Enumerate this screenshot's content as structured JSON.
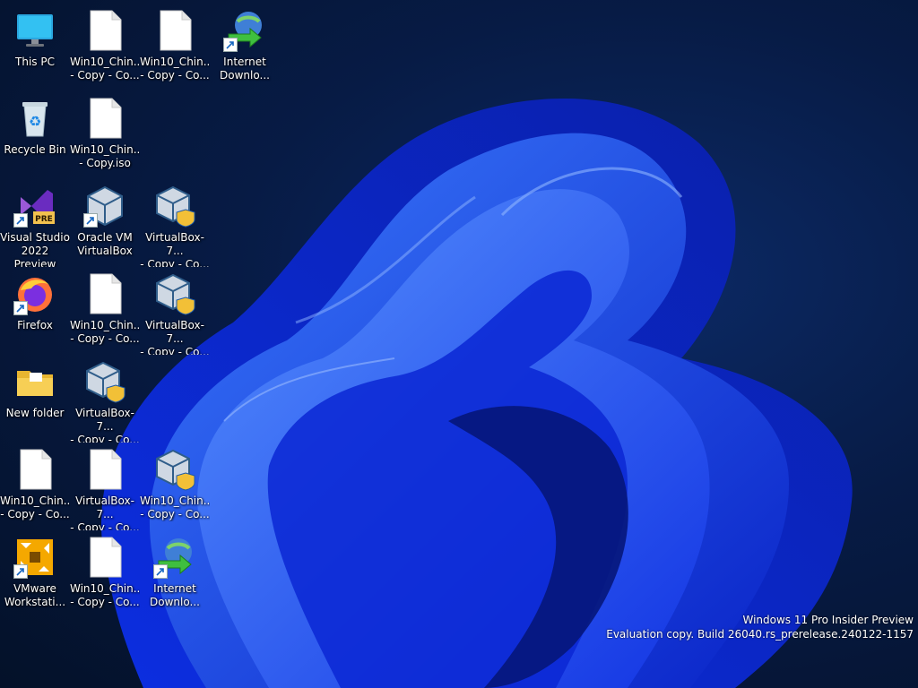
{
  "desktop": {
    "icons": [
      {
        "label": "This PC",
        "type": "pc"
      },
      {
        "label": "Win10_Chin...\n- Copy - Co...",
        "type": "file"
      },
      {
        "label": "Win10_Chin...\n- Copy - Co...",
        "type": "file"
      },
      {
        "label": "Internet\nDownlo...",
        "type": "idm",
        "shortcut": true
      },
      {
        "label": "Recycle Bin",
        "type": "recycle"
      },
      {
        "label": "Win10_Chin...\n- Copy.iso",
        "type": "file"
      },
      {
        "label": "Visual Studio\n2022 Preview",
        "type": "vs",
        "shortcut": true
      },
      {
        "label": "Oracle VM\nVirtualBox",
        "type": "vbox",
        "shortcut": true
      },
      {
        "label": "VirtualBox-7...\n- Copy - Co...",
        "type": "vboxsetup"
      },
      {
        "label": "Firefox",
        "type": "firefox",
        "shortcut": true
      },
      {
        "label": "Win10_Chin...\n- Copy - Co...",
        "type": "file"
      },
      {
        "label": "VirtualBox-7...\n- Copy - Co...",
        "type": "vboxsetup"
      },
      {
        "label": "New folder",
        "type": "folder"
      },
      {
        "label": "VirtualBox-7...\n- Copy - Co...",
        "type": "vboxsetup"
      },
      {
        "label": "Win10_Chin...\n- Copy - Co...",
        "type": "file"
      },
      {
        "label": "Win10_Chin...\n- Copy - Co...",
        "type": "file"
      },
      {
        "label": "VirtualBox-7...\n- Copy - Co...",
        "type": "vboxsetup"
      },
      {
        "label": "VMware\nWorkstati...",
        "type": "vmware",
        "shortcut": true
      },
      {
        "label": "Win10_Chin...\n- Copy - Co...",
        "type": "file"
      },
      {
        "label": "Internet\nDownlo...",
        "type": "idm",
        "shortcut": true
      }
    ]
  },
  "watermark": {
    "line1": "Windows 11 Pro Insider Preview",
    "line2": "Evaluation copy. Build 26040.rs_prerelease.240122-1157"
  },
  "badges": {
    "vs": "PRE"
  },
  "colors": {
    "accent": "#1f4bff",
    "wallpaper_dark": "#041129"
  }
}
